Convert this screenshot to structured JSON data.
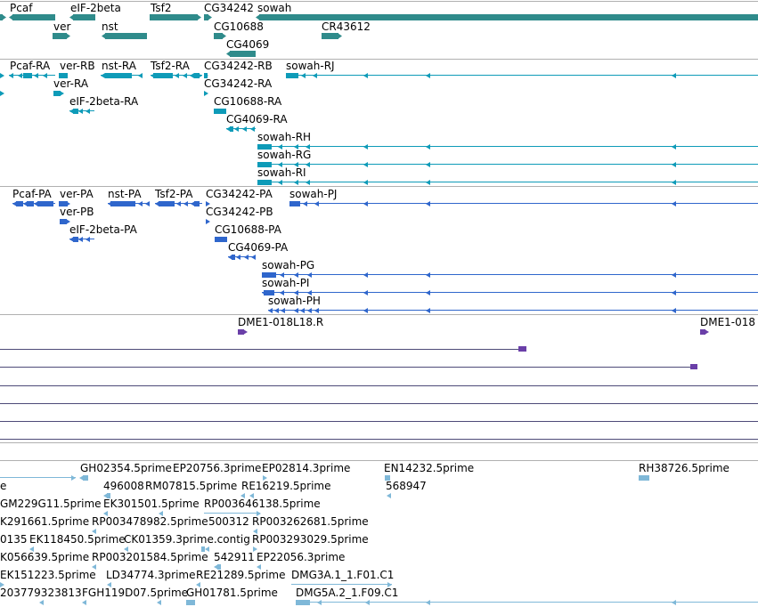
{
  "colors": {
    "gene": "#2f8b8b",
    "transcript": "#0e9bb8",
    "protein": "#2f66cc",
    "repeat": "#6a3fa8",
    "repeat_line": "#4d4a78",
    "est": "#7fb8d8",
    "divider": "#aaaaaa",
    "label": "#000000"
  },
  "tracks": {
    "genes": {
      "labels": [
        "Pcaf",
        "eIF-2beta",
        "Tsf2",
        "CG34242",
        "sowah",
        "ver",
        "nst",
        "CR43612",
        "CG10688",
        "CG4069"
      ]
    },
    "transcripts": {
      "labels": [
        "Pcaf-RA",
        "ver-RB",
        "nst-RA",
        "Tsf2-RA",
        "CG34242-RB",
        "sowah-RJ",
        "ver-RA",
        "CG34242-RA",
        "eIF-2beta-RA",
        "CG10688-RA",
        "CG4069-RA",
        "sowah-RH",
        "sowah-RG",
        "sowah-RI"
      ]
    },
    "proteins": {
      "labels": [
        "Pcaf-PA",
        "ver-PA",
        "nst-PA",
        "Tsf2-PA",
        "CG34242-PA",
        "sowah-PJ",
        "ver-PB",
        "CG34242-PB",
        "eIF-2beta-PA",
        "CG10688-PA",
        "CG4069-PA",
        "sowah-PG",
        "sowah-PI",
        "sowah-PH"
      ]
    },
    "repeats": {
      "labels": [
        "DME1-018L18.R",
        "DME1-018"
      ]
    },
    "ests": {
      "labels": [
        "GH02354.5prime",
        "EP20756.3prime",
        "EP02814.3prime",
        "EN14232.5prime",
        "RH38726.5prime",
        "e",
        "496008",
        "RM07815.5prime",
        "RE16219.5prime",
        "568947",
        "GM229G11.5prime",
        "EK301501.5prime",
        "RP003646138.5prime",
        "K291661.5prime",
        "RP003478982.5prime",
        "500312",
        "RP003262681.5prime",
        "0135",
        "EK118450.5prime",
        "CK01359.3prime.contig",
        "RP003293029.5prime",
        "K056639.5prime",
        "RP003201584.5prime",
        "542911",
        "EP22056.3prime",
        "EK151223.5prime",
        "LD34774.3prime",
        "RE21289.5prime",
        "DMG3A.1_1.F01.C1",
        "203779323813",
        "FGH119D07.5prime",
        "GH01781.5prime",
        "DMG5A.2_1.F09.C1"
      ]
    }
  }
}
